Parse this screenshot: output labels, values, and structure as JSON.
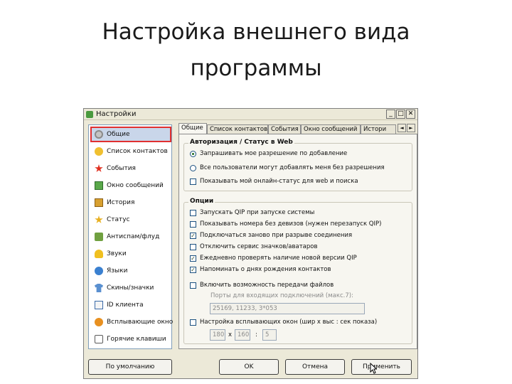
{
  "slide": {
    "title_line1": "Настройка внешнего вида",
    "title_line2": "программы"
  },
  "window": {
    "title": "Настройки",
    "controls": {
      "minimize": "_",
      "maximize": "□",
      "close": "✕"
    }
  },
  "sidebar": {
    "items": [
      {
        "label": "Общие",
        "icon": "settings-icon",
        "selected": true
      },
      {
        "label": "Список контактов",
        "icon": "contacts-icon"
      },
      {
        "label": "События",
        "icon": "events-icon"
      },
      {
        "label": "Окно сообщений",
        "icon": "message-window-icon"
      },
      {
        "label": "История",
        "icon": "history-icon"
      },
      {
        "label": "Статус",
        "icon": "status-icon"
      },
      {
        "label": "Антиспам/флуд",
        "icon": "antispam-icon"
      },
      {
        "label": "Звуки",
        "icon": "sounds-icon"
      },
      {
        "label": "Языки",
        "icon": "languages-icon"
      },
      {
        "label": "Скины/значки",
        "icon": "skins-icon"
      },
      {
        "label": "ID клиента",
        "icon": "client-id-icon"
      },
      {
        "label": "Всплывающие окно",
        "icon": "popup-icon"
      },
      {
        "label": "Горячие клавиши",
        "icon": "hotkeys-icon"
      }
    ]
  },
  "tabs": {
    "items": [
      {
        "label": "Общие",
        "active": true
      },
      {
        "label": "Список контактов"
      },
      {
        "label": "События"
      },
      {
        "label": "Окно сообщений"
      },
      {
        "label": "Истори"
      }
    ],
    "scroll_left": "◄",
    "scroll_right": "►"
  },
  "auth_group": {
    "title": "Авторизация / Статус в Web",
    "radio1": "Запрашивать мое разрешение по добавление",
    "radio2": "Все пользователи могут добавлять меня без разрешения",
    "radio_selected": 1,
    "check_web": "Показывать мой онлайн-статус для web и поиска",
    "check_web_checked": false
  },
  "options_group": {
    "title": "Опции",
    "items": [
      {
        "label": "Запускать QIP при запуске системы",
        "checked": false
      },
      {
        "label": "Показывать номера без девизов (нужен перезапуск QIP)",
        "checked": false
      },
      {
        "label": "Подключаться заново при разрыве соединения",
        "checked": true
      },
      {
        "label": "Отключить сервис значков/аватаров",
        "checked": false
      },
      {
        "label": "Ежедневно проверять наличие новой версии QIP",
        "checked": true
      },
      {
        "label": "Напоминать о днях рождения контактов",
        "checked": true
      }
    ],
    "file_transfer_label": "Включить возможность передачи файлов",
    "file_transfer_checked": false,
    "ports_label": "Порты для входящих подключений (макс.7):",
    "ports_value": "25169, 11233, 3*053",
    "popup_label": "Настройка всплывающих окон (шир x выс : сек показа)",
    "popup_checked": false,
    "popup_width": "180",
    "x_sign": "x",
    "popup_height": "160",
    "colon": ":",
    "popup_seconds": "5"
  },
  "buttons": {
    "defaults": "По умолчанию",
    "ok": "OK",
    "cancel": "Отмена",
    "apply": "Применить"
  },
  "colors": {
    "selection_outline": "#e03030",
    "window_bg": "#ece9d8",
    "panel_bg": "#f7f6f0"
  }
}
